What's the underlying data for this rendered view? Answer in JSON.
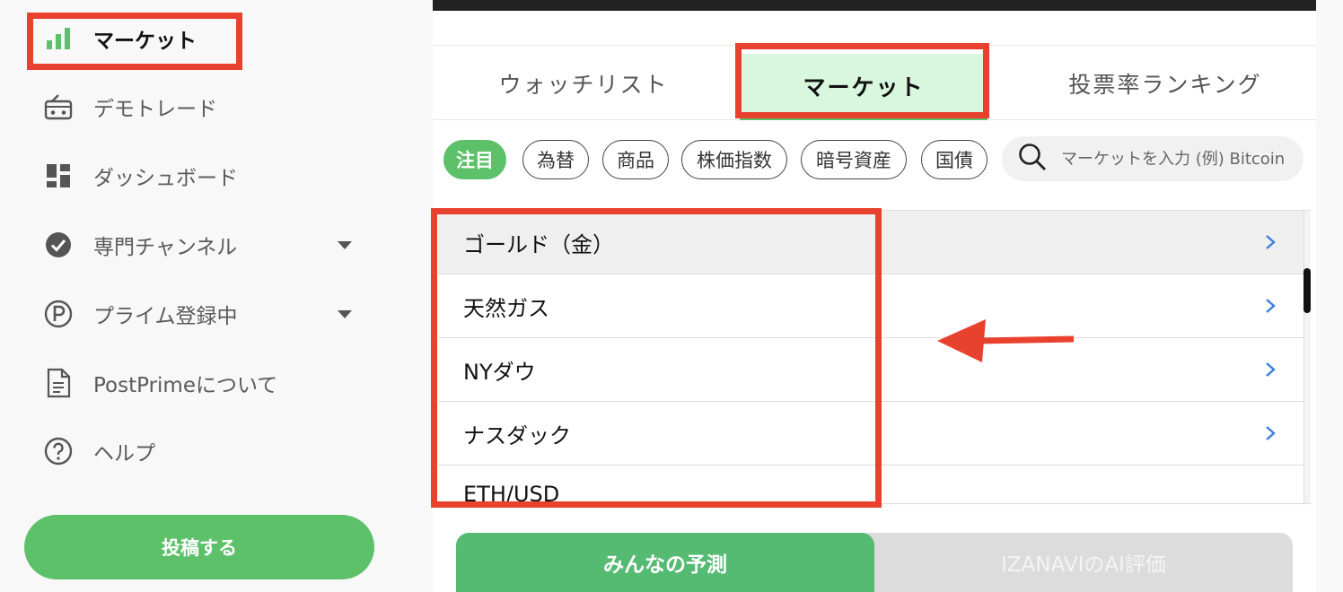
{
  "sidebar": {
    "items": [
      {
        "label": "マーケット",
        "icon": "bar-chart-icon"
      },
      {
        "label": "デモトレード",
        "icon": "radio-icon"
      },
      {
        "label": "ダッシュボード",
        "icon": "dashboard-icon"
      },
      {
        "label": "専門チャンネル",
        "icon": "check-circle-icon"
      },
      {
        "label": "プライム登録中",
        "icon": "p-circle-icon"
      },
      {
        "label": "PostPrimeについて",
        "icon": "document-icon"
      },
      {
        "label": "ヘルプ",
        "icon": "help-icon"
      }
    ],
    "post_button": "投稿する"
  },
  "tabs": [
    {
      "label": "ウォッチリスト"
    },
    {
      "label": "マーケット"
    },
    {
      "label": "投票率ランキング"
    }
  ],
  "chips": [
    "注目",
    "為替",
    "商品",
    "株価指数",
    "暗号資産",
    "国債"
  ],
  "search": {
    "placeholder": "マーケットを入力 (例) Bitcoin"
  },
  "market_list": [
    "ゴールド（金）",
    "天然ガス",
    "NYダウ",
    "ナスダック",
    "ETH/USD"
  ],
  "bottom_tabs": [
    "みんなの予測",
    "IZANAVIのAI評価"
  ],
  "colors": {
    "accent_green": "#5dc16a",
    "annotation_red": "#e8412e",
    "chevron_blue": "#3b7fe0"
  }
}
